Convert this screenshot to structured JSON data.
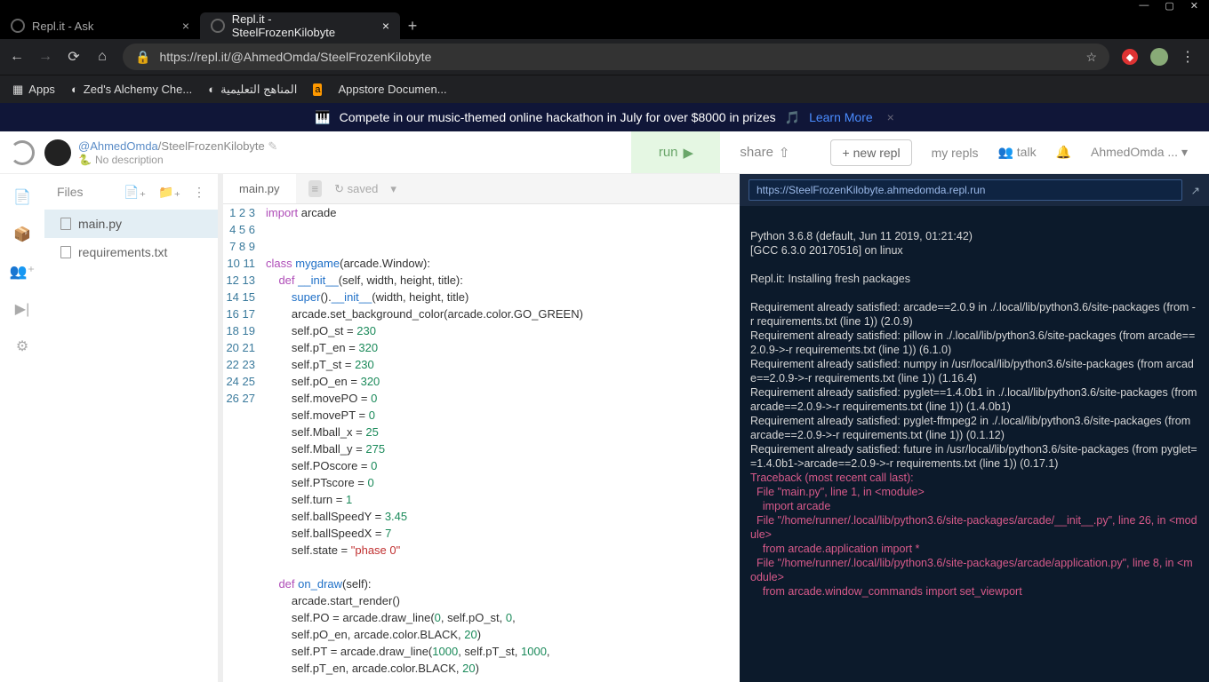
{
  "browser": {
    "tabs": [
      {
        "title": "Repl.it - Ask",
        "active": false
      },
      {
        "title": "Repl.it - SteelFrozenKilobyte",
        "active": true
      }
    ],
    "url": "https://repl.it/@AhmedOmda/SteelFrozenKilobyte",
    "bookmarks": [
      "Apps",
      "Zed's Alchemy Che...",
      "المناهج التعليمية",
      "Appstore Documen..."
    ]
  },
  "promo": {
    "text": "Compete in our music-themed online hackathon in July for over $8000 in prizes",
    "link": "Learn More"
  },
  "header": {
    "user": "@AhmedOmda",
    "sep": "/",
    "repo": "SteelFrozenKilobyte",
    "desc": "No description",
    "run": "run",
    "share": "share",
    "newrepl": "new repl",
    "myrepls": "my repls",
    "talk": "talk",
    "account": "AhmedOmda ..."
  },
  "files": {
    "title": "Files",
    "items": [
      "main.py",
      "requirements.txt"
    ]
  },
  "editor": {
    "tab": "main.py",
    "saved": "saved",
    "code_html": "<span class='kw'>import</span> arcade\n\n\n<span class='kw'>class</span> <span class='fn'>mygame</span>(arcade.Window):\n    <span class='kw'>def</span> <span class='fn'>__init__</span>(self, width, height, title):\n        <span class='sup'>super</span>().<span class='fn'>__init__</span>(width, height, title)\n        arcade.set_background_color(arcade.color.GO_GREEN)\n        self.pO_st = <span class='num'>230</span>\n        self.pT_en = <span class='num'>320</span>\n        self.pT_st = <span class='num'>230</span>\n        self.pO_en = <span class='num'>320</span>\n        self.movePO = <span class='num'>0</span>\n        self.movePT = <span class='num'>0</span>\n        self.Mball_x = <span class='num'>25</span>\n        self.Mball_y = <span class='num'>275</span>\n        self.POscore = <span class='num'>0</span>\n        self.PTscore = <span class='num'>0</span>\n        self.turn = <span class='num'>1</span>\n        self.ballSpeedY = <span class='num'>3.45</span>\n        self.ballSpeedX = <span class='num'>7</span>\n        self.state = <span class='str'>\"phase 0\"</span>\n\n    <span class='kw'>def</span> <span class='fn'>on_draw</span>(self):\n        arcade.start_render()\n        self.PO = arcade.draw_line(<span class='num'>0</span>, self.pO_st, <span class='num'>0</span>,\n        self.pO_en, arcade.color.BLACK, <span class='num'>20</span>)\n        self.PT = arcade.draw_line(<span class='num'>1000</span>, self.pT_st, <span class='num'>1000</span>,\n        self.pT_en, arcade.color.BLACK, <span class='num'>20</span>)",
    "line_count": 27
  },
  "console": {
    "url": "https://SteelFrozenKilobyte.ahmedomda.repl.run",
    "out1": "Python 3.6.8 (default, Jun 11 2019, 01:21:42)\n[GCC 6.3.0 20170516] on linux",
    "out2": "Repl.it: Installing fresh packages",
    "out3": "Requirement already satisfied: arcade==2.0.9 in ./.local/lib/python3.6/site-packages (from -r requirements.txt (line 1)) (2.0.9)\nRequirement already satisfied: pillow in ./.local/lib/python3.6/site-packages (from arcade==2.0.9->-r requirements.txt (line 1)) (6.1.0)\nRequirement already satisfied: numpy in /usr/local/lib/python3.6/site-packages (from arcade==2.0.9->-r requirements.txt (line 1)) (1.16.4)\nRequirement already satisfied: pyglet==1.4.0b1 in ./.local/lib/python3.6/site-packages (from arcade==2.0.9->-r requirements.txt (line 1)) (1.4.0b1)\nRequirement already satisfied: pyglet-ffmpeg2 in ./.local/lib/python3.6/site-packages (from arcade==2.0.9->-r requirements.txt (line 1)) (0.1.12)\nRequirement already satisfied: future in /usr/local/lib/python3.6/site-packages (from pyglet==1.4.0b1->arcade==2.0.9->-r requirements.txt (line 1)) (0.17.1)",
    "err": "Traceback (most recent call last):\n  File \"main.py\", line 1, in <module>\n    import arcade\n  File \"/home/runner/.local/lib/python3.6/site-packages/arcade/__init__.py\", line 26, in <module>\n    from arcade.application import *\n  File \"/home/runner/.local/lib/python3.6/site-packages/arcade/application.py\", line 8, in <module>\n    from arcade.window_commands import set_viewport"
  }
}
